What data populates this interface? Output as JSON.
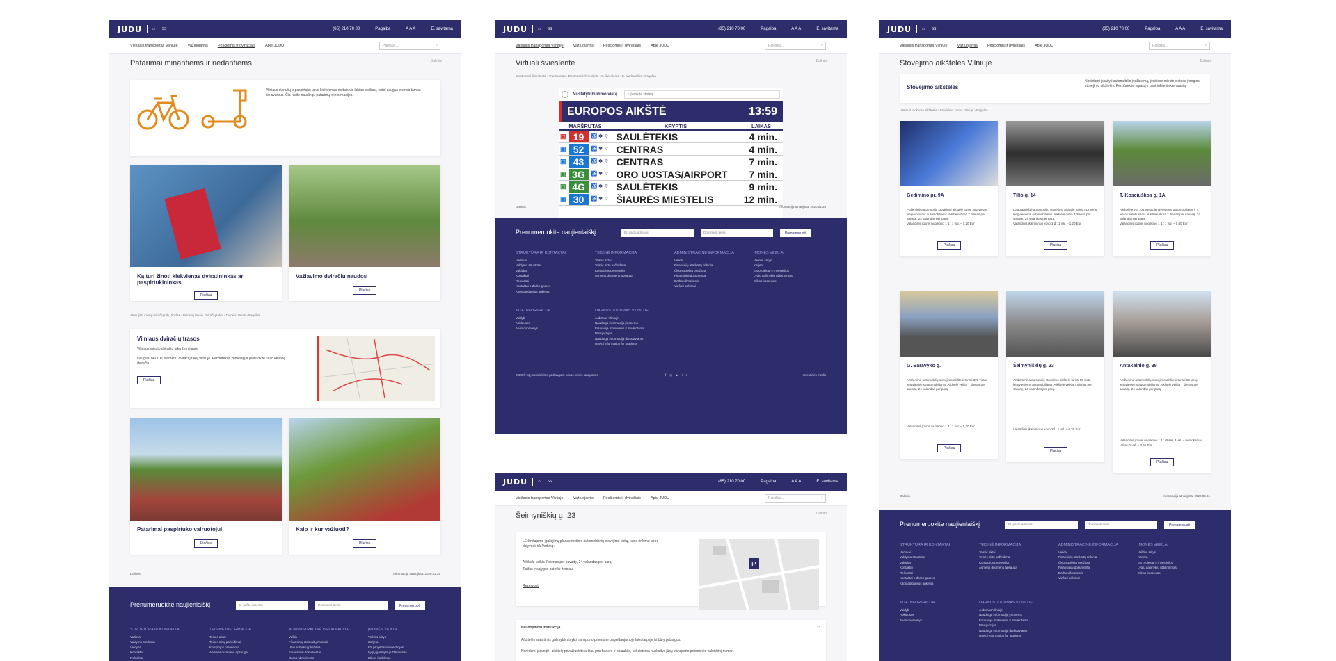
{
  "header": {
    "logo": "JUDU",
    "phone": "(85) 210 70 00",
    "help": "Pagalba",
    "lang": "A A A",
    "eshop": "E. savitarna"
  },
  "nav": {
    "items": [
      "Viešasis transportas Vilniuje",
      "Važiuojantis",
      "Pėsčiomis ir dviračiais",
      "Apie JUDU"
    ],
    "search_placeholder": "Paieška ..."
  },
  "share": "Dalintis",
  "shared_label": "Dalintis",
  "p1": {
    "title": "Patarimai minantiems ir riedantiems",
    "intro": "Vilniaus dviračių ir paspirtukų takai kiekvienais metais vis labiau plečiasi, todėl saugus eismas tampa itin svarbus. Čia rasite naudingų patarimų ir informacijos.",
    "cards": [
      {
        "title": "Ką turi žinoti kiekvienas dviratininkas ar paspirtukininkas",
        "btn": "Plačiau"
      },
      {
        "title": "Važiavimo dviračiu naudos",
        "btn": "Plačiau"
      },
      {
        "title": "Patarimai paspirtuko vairuotojui",
        "btn": "Plačiau"
      },
      {
        "title": "Kaip ir kur važiuoti?",
        "btn": "Plačiau"
      }
    ],
    "breadcrumb": [
      "Atnaujinti",
      "Visų dviračių takų tinklas",
      "Dviračių takai",
      "Dviračių takai",
      "Dviračių takas",
      "Pagalba"
    ],
    "map_card": {
      "title": "Vilniaus dviračių trasos",
      "line1": "Vilniaus miesto dviračių takų žemėlapis",
      "line2": "Daugiau nei 100 kilometrų dviračių takų Vilniuje. Peržiūrėkite žemėlapį ir planuokite savo kelionę dviračiu.",
      "btn": "Plačiau"
    },
    "updated": "Informacija atnaujinta: 2020.02.26"
  },
  "p2": {
    "title": "Virtuali švieslentė",
    "breadcrumb": [
      "Elektroninė švieslentė",
      "Transportas",
      "Elektroninė švieslentė",
      "E. švieslentė",
      "E. tvarkaraštis",
      "Pagalba"
    ],
    "locate_label": "Nustatyti buvimo vietą",
    "stop_placeholder": "Įveskite stotelę",
    "stop_name": "EUROPOS AIKŠTĖ",
    "clock": "13:59",
    "cols": [
      "MARŠRUTAS",
      "KRYPTIS",
      "LAIKAS"
    ],
    "rows": [
      {
        "num": "19",
        "color": "#d32f2f",
        "dir": "SAULĖTEKIS",
        "time": "4 min."
      },
      {
        "num": "52",
        "color": "#1976d2",
        "dir": "CENTRAS",
        "time": "4 min."
      },
      {
        "num": "43",
        "color": "#1976d2",
        "dir": "CENTRAS",
        "time": "7 min."
      },
      {
        "num": "3G",
        "color": "#388e3c",
        "dir": "ORO UOSTAS/AIRPORT",
        "time": "7 min."
      },
      {
        "num": "4G",
        "color": "#388e3c",
        "dir": "SAULĖTEKIS",
        "time": "9 min."
      },
      {
        "num": "30",
        "color": "#1976d2",
        "dir": "ŠIAURĖS MIESTELIS",
        "time": "12 min."
      }
    ],
    "updated": "Informacija atnaujinta: 2020.02.26"
  },
  "footer": {
    "subscribe": "Prenumeruokite naujienlaiškį",
    "email_placeholder": "El. pašto adresas",
    "topic_placeholder": "Dominanti tema",
    "subscribe_btn": "Prenumeruoti",
    "col1_title": "STRUKTŪRA IR KONTAKTAI",
    "col1": [
      "Vadovai",
      "Valdymo struktūra",
      "Valdyba",
      "Kontaktai",
      "Rekvizitai",
      "Kontaktai ir darbo grupės",
      "Kitos apklausos anketos"
    ],
    "col2_title": "TEISINĖ INFORMACIJA",
    "col2": [
      "Teisės aktai",
      "Teisės aktų pažeidimai",
      "Korupcijos prevencija",
      "Asmens duomenų apsauga"
    ],
    "col3_title": "ADMINISTRACINĖ INFORMACIJA",
    "col3": [
      "Veikla",
      "Finansinių ataskaitų rinkiniai",
      "Ūkio subjektų priežiūra",
      "Finansiniai dokumentai",
      "Darbo užmokestis",
      "Viešieji pirkimai"
    ],
    "col4_title": "ĮMONĖS VEIKLA",
    "col4": [
      "Veiklos sritys",
      "Karjera",
      "ES projektai ir investicijos",
      "Lygių galimybių užtikrinimas",
      "Etikos kodeksas"
    ],
    "col5_title": "KITA INFORMACIJA",
    "col5": [
      "Vaidyb",
      "Apklausos",
      "Atviri duomenys"
    ],
    "col6_title": "DARNUS JUDUMAS VILNIUJE",
    "col6": [
      "Judumas Vilniuje",
      "Naudinga informacija įmonėms",
      "Edukacija mokiniams ir studentams",
      "Mūsų vizijos",
      "Naudinga informacija darbdaviams",
      "Useful information for students"
    ],
    "copyright": "2020 © SĮ „Susisiekimo paslaugos“. Visos teisės saugomos",
    "bottom_right": "Svetainės medis"
  },
  "p3": {
    "title": "Šeimyniškių g. 23",
    "text1": "LE šimtajame įgaliojimų planas metinio automobilinių stovėjimo vietų, kurie rinkimų tarpe dalyvauti tik Parking.",
    "text2": "Aikštelė veikia 7 dienas per savaitę, 24 valandas per parą.",
    "text3": "Tarifas ir sąlygos pateikti žemiau.",
    "link": "Rezervuoti",
    "acc_title": "Naudojimosi instrukcija",
    "acc_line1": "Aikštelės sutartimis galimybė atvykti transporto priemone pageidaujamoje laikotarpyje iki būry pabaigos.",
    "acc_line2": "Norėdami įsijungti į aikštelę privažiuokite arčiau prie barjero ir palaukite, kol sistema nuskaitys jūsų transporto priemonės valstybinį numerį."
  },
  "p4": {
    "title": "Stovėjimo aikštelės Vilniuje",
    "banner_title": "Stovėjimo aikštelės",
    "banner_text": "Norėdami įskaityti automobilio įvažiavimą, įvairiose miesto vietose įrengtos stovėjimo aikštelės. Peržiūrėkite sąrašą ir pasirinkite tinkamiausią.",
    "breadcrumb": [
      "Vietos ir mokumo aikštelės",
      "Stovėjimo zonos Vilniuje",
      "Pagalba"
    ],
    "lots": [
      {
        "name": "Gedimino pr. 9A",
        "desc": "Požeminė automobilių stovėjimo aikštelė turinti 262 vietas lengvuosiams automobiliams. Aikštelė dirba 7 dienas per savaitę, 24 valandas per parą.",
        "price": "Valandinis įkainis nuo kovo 1 d.: 1 val. – 1,20 Eur",
        "btn": "Plačiau"
      },
      {
        "name": "Tilto g. 14",
        "desc": "Daugiaaukštė automobilių stovėjimo aikštelė turinti 512 vietų lengviesiems automobiliams. Aikštelė dirba 7 dienas per savaitę, 24 valandas per parą.",
        "price": "Valandinis įkainis nuo kovo 1 d.: 1 val. – 1,20 Eur",
        "btn": "Plačiau"
      },
      {
        "name": "T. Kosciuškos g. 1A",
        "desc": "Aikštelėje yra 104 vietos lengviesiems automobiliams ir 4 vietos autobusams. Aikštelė dirba 7 dienas per savaitę, 24 valandas per parą.",
        "price": "Valandinis įkainis nuo kovo 1 d.: 1 val. – 0,80 Eur",
        "btn": "Plačiau"
      },
      {
        "name": "G. Baravyko g.",
        "desc": "Antžeminė automobilių stovėjimo aikštelė turinti 306 vietas lengviesiems automobiliams. Aikštelė veikia 7 dienas per savaitę, 24 valandas per parą.",
        "price": "Valandinis įkainis nuo kovo 1 d.: 1 val. – 0,30 Eur",
        "btn": "Plačiau"
      },
      {
        "name": "Šeimyniškių g. 23",
        "desc": "Antžeminė automobilių stovėjimo aikštelė turinti 50 vietų lengviesiems automobiliams. Aikštelė veikia 7 dienas per savaitę, 24 valandas per parą.",
        "price": "Valandinis įkainis nuo kovo 1d.: 1 val. – 0,20 Eur",
        "btn": "Plačiau"
      },
      {
        "name": "Antakalnio g. 39",
        "desc": "Antžeminė automobilių stovėjimo aikštelė turinti 63 vietų lengviesiems automobiliams. Aikštelė veikia 7 dienas per savaitę, 24 valandas per parą.",
        "price": "Valandinis įkainis nuo kovo 1 d.: ištisas 3 val. – nemokamai. Vėliau 1 val. – 0,60 Eur.",
        "btn": "Plačiau"
      }
    ],
    "updated": "Informacija atnaujinta: 2020.06.01"
  },
  "colors": {
    "brand": "#2d2d6b",
    "accent": "#e38a1a"
  }
}
